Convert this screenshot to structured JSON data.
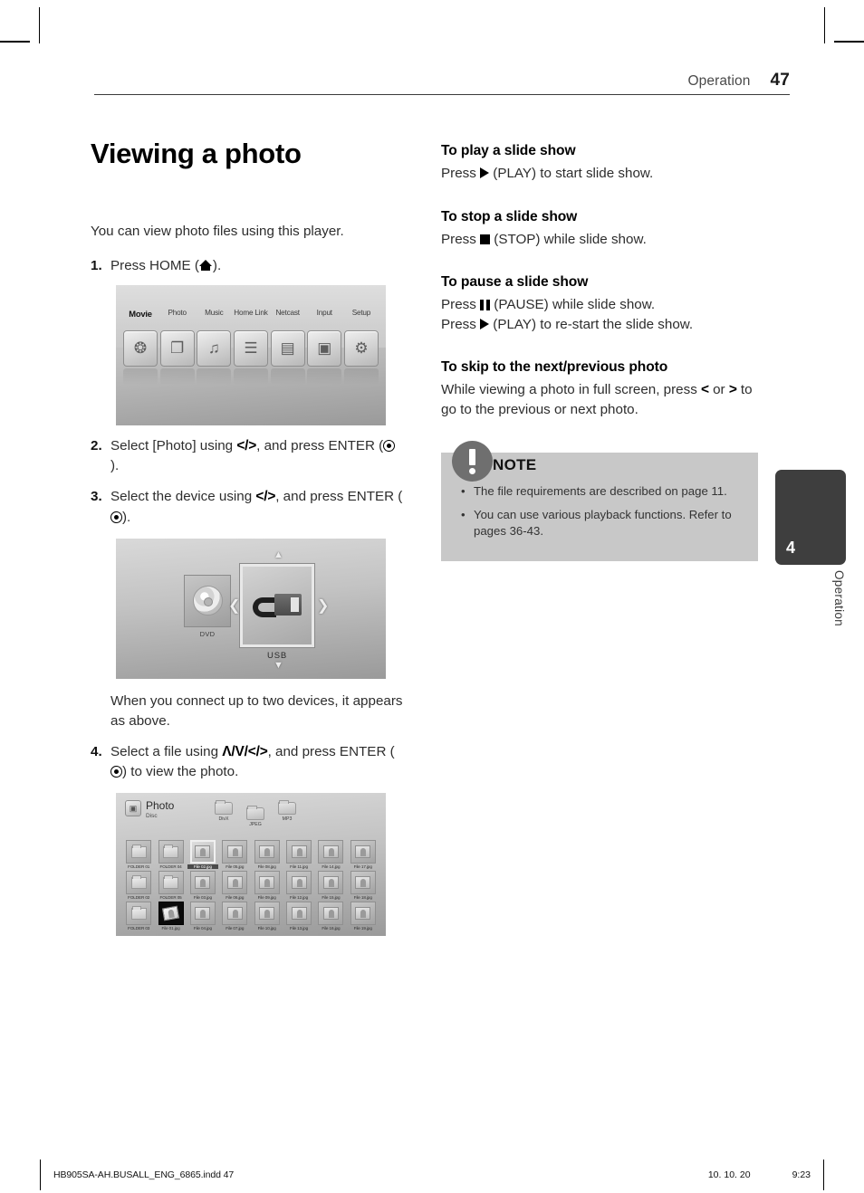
{
  "header": {
    "section": "Operation",
    "page_number": "47"
  },
  "left_column": {
    "title": "Viewing a photo",
    "intro": "You can view photo files using this player.",
    "steps": [
      {
        "num": "1.",
        "text_before": "Press HOME (",
        "icon": "home-icon",
        "text_after": ")."
      },
      {
        "num": "2.",
        "text_before": "Select [Photo] using ",
        "symbol": "</>",
        "text_mid": ", and press ENTER (",
        "icon": "enter-icon",
        "text_after": ")."
      },
      {
        "num": "3.",
        "text_before": "Select the device using ",
        "symbol": "</>",
        "text_mid": ", and press ENTER (",
        "icon": "enter-icon",
        "text_after": ")."
      },
      {
        "num": "4.",
        "text_before": "Select a file using ",
        "symbol": "Λ/V/</>",
        "text_mid": ", and press ENTER (",
        "icon": "enter-icon",
        "text_after": ") to view the photo."
      }
    ],
    "caption_devices": "When you connect up to two devices, it appears as above."
  },
  "figures": {
    "home_menu": {
      "name": "home-menu-screen",
      "items": [
        {
          "label": "Movie",
          "icon": "film-reel-icon",
          "glyph": "❂",
          "selected": true
        },
        {
          "label": "Photo",
          "icon": "photo-icon",
          "glyph": "❐",
          "selected": false
        },
        {
          "label": "Music",
          "icon": "music-note-icon",
          "glyph": "♫",
          "selected": false
        },
        {
          "label": "Home Link",
          "icon": "home-link-icon",
          "glyph": "☰",
          "selected": false
        },
        {
          "label": "Netcast",
          "icon": "netcast-icon",
          "glyph": "▤",
          "selected": false
        },
        {
          "label": "Input",
          "icon": "input-icon",
          "glyph": "▣",
          "selected": false
        },
        {
          "label": "Setup",
          "icon": "gear-icon",
          "glyph": "⚙",
          "selected": false
        }
      ]
    },
    "device_select": {
      "name": "device-select-screen",
      "devices": [
        {
          "label": "DVD",
          "icon": "disc-icon",
          "selected": false
        },
        {
          "label": "USB",
          "icon": "usb-plug-icon",
          "selected": true
        }
      ],
      "arrows": {
        "up": "▲",
        "down": "▼",
        "left": "❮",
        "right": "❯"
      }
    },
    "photo_browser": {
      "name": "photo-browser-screen",
      "title": "Photo",
      "subtitle": "Disc",
      "crumbs": [
        {
          "label": "DivX"
        },
        {
          "label": "JPEG"
        },
        {
          "label": "MP3"
        }
      ],
      "grid": [
        [
          {
            "label": "FOLDER 01",
            "type": "folder"
          },
          {
            "label": "FOLDER 04",
            "type": "folder"
          },
          {
            "label": "File 02.jpg",
            "type": "photo",
            "selected": true
          },
          {
            "label": "File 05.jpg",
            "type": "photo"
          },
          {
            "label": "File 08.jpg",
            "type": "photo"
          },
          {
            "label": "File 11.jpg",
            "type": "photo"
          },
          {
            "label": "File 14.jpg",
            "type": "photo"
          },
          {
            "label": "File 17.jpg",
            "type": "photo"
          }
        ],
        [
          {
            "label": "FOLDER 02",
            "type": "folder"
          },
          {
            "label": "FOLDER 05",
            "type": "folder"
          },
          {
            "label": "File 03.jpg",
            "type": "photo"
          },
          {
            "label": "File 06.jpg",
            "type": "photo"
          },
          {
            "label": "File 09.jpg",
            "type": "photo"
          },
          {
            "label": "File 12.jpg",
            "type": "photo"
          },
          {
            "label": "File 15.jpg",
            "type": "photo"
          },
          {
            "label": "File 18.jpg",
            "type": "photo"
          }
        ],
        [
          {
            "label": "FOLDER 03",
            "type": "folder"
          },
          {
            "label": "File 01.jpg",
            "type": "photo",
            "thumb": "black"
          },
          {
            "label": "File 04.jpg",
            "type": "photo"
          },
          {
            "label": "File 07.jpg",
            "type": "photo"
          },
          {
            "label": "File 10.jpg",
            "type": "photo"
          },
          {
            "label": "File 13.jpg",
            "type": "photo"
          },
          {
            "label": "File 16.jpg",
            "type": "photo"
          },
          {
            "label": "File 19.jpg",
            "type": "photo"
          }
        ]
      ]
    }
  },
  "right_column": {
    "sections": [
      {
        "heading": "To play a slide show",
        "lines": [
          {
            "before": "Press ",
            "icon": "play-icon",
            "after": " (PLAY) to start slide show."
          }
        ]
      },
      {
        "heading": "To stop a slide show",
        "lines": [
          {
            "before": "Press ",
            "icon": "stop-icon",
            "after": " (STOP) while slide show."
          }
        ]
      },
      {
        "heading": "To pause a slide show",
        "lines": [
          {
            "before": "Press ",
            "icon": "pause-icon",
            "after": " (PAUSE) while slide show."
          },
          {
            "before": "Press ",
            "icon": "play-icon",
            "after": " (PLAY) to re-start the slide show."
          }
        ]
      },
      {
        "heading": "To skip to the next/previous photo",
        "lines": [
          {
            "before": "While viewing a photo in full screen, press ",
            "symbol": "<",
            "mid": " or ",
            "symbol2": ">",
            "after": " to go to the previous or next photo."
          }
        ]
      }
    ],
    "note": {
      "label": "NOTE",
      "icon": "exclamation-icon",
      "bullet": "•",
      "items": [
        "The file requirements are described on page 11.",
        "You can use various playback functions. Refer to pages 36-43."
      ]
    }
  },
  "side_tab": {
    "number": "4",
    "label": "Operation"
  },
  "footer": {
    "filename": "HB905SA-AH.BUSALL_ENG_6865.indd   47",
    "date": "10. 10. 20",
    "time": "9:23"
  },
  "colors": {
    "note_box_bg": "#c8c8c8",
    "note_icon_bg": "#6f6f6f",
    "side_tab_bg": "#3e3e3e",
    "text": "#2d2d2d"
  }
}
